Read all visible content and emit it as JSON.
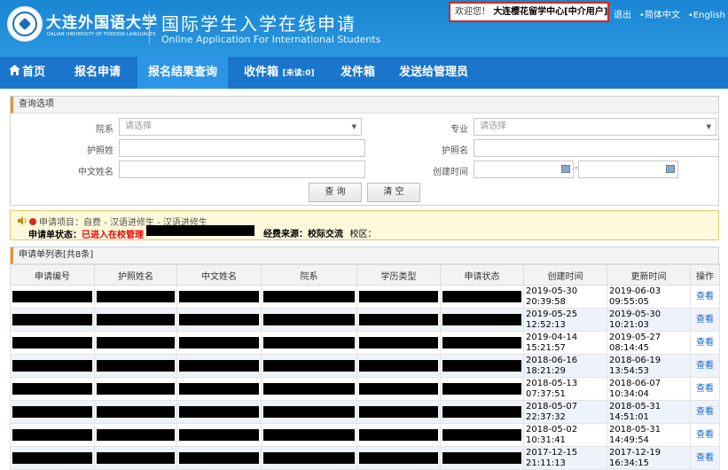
{
  "header": {
    "logo_cn": "大连外国语大学",
    "logo_en": "DALIAN UNIVERSITY OF FOREIGN LANGUAGES",
    "title_cn": "国际学生入学在线申请",
    "title_en": "Online Application For International Students",
    "welcome_prefix": "欢迎您！",
    "welcome_user": "大连樱花留学中心[中介用户]",
    "logout": "退出",
    "lang_cn": "•简体中文",
    "lang_en": "•English"
  },
  "nav": {
    "home": "首页",
    "apply": "报名申请",
    "result": "报名结果查询",
    "inbox": "收件箱",
    "inbox_unread": "[未读:0]",
    "outbox": "发件箱",
    "send_admin": "发送给管理员"
  },
  "query": {
    "title": "查询选项",
    "department_label": "院系",
    "department_placeholder": "请选择",
    "major_label": "专业",
    "major_placeholder": "请选择",
    "passport_surname_label": "护照姓",
    "passport_givenname_label": "护照名",
    "chinese_name_label": "中文姓名",
    "created_time_label": "创建时间",
    "date_sep": "-",
    "search_button": "查 询",
    "clear_button": "清 空"
  },
  "notice": {
    "project_label": "申请项目：",
    "project_value": "自费 - 汉语进修生 - 汉语进修生",
    "status_label": "申请单状态：",
    "status_value": "已进入在校管理",
    "fee_label": "经费来源：",
    "fee_value": "校际交流",
    "campus_label": "校区："
  },
  "list": {
    "title": "申请单列表[共8条]",
    "columns": [
      "申请编号",
      "护照姓名",
      "中文姓名",
      "院系",
      "学历类型",
      "申请状态",
      "创建时间",
      "更新时间",
      "操作"
    ],
    "action_label": "查看",
    "rows": [
      {
        "created": "2019-05-30 20:39:58",
        "updated": "2019-06-03 09:55:05"
      },
      {
        "created": "2019-05-25 12:52:13",
        "updated": "2019-05-30 10:21:03"
      },
      {
        "created": "2019-04-14 15:21:57",
        "updated": "2019-05-27 08:14:45"
      },
      {
        "created": "2018-06-16 18:21:29",
        "updated": "2018-06-19 13:54:53"
      },
      {
        "created": "2018-05-13 07:37:51",
        "updated": "2018-06-07 10:34:04"
      },
      {
        "created": "2018-05-07 22:37:32",
        "updated": "2018-05-31 14:51:01"
      },
      {
        "created": "2018-05-02 10:31:41",
        "updated": "2018-05-31 14:49:54"
      },
      {
        "created": "2017-12-15 21:11:13",
        "updated": "2017-12-19 16:34:15"
      }
    ]
  }
}
